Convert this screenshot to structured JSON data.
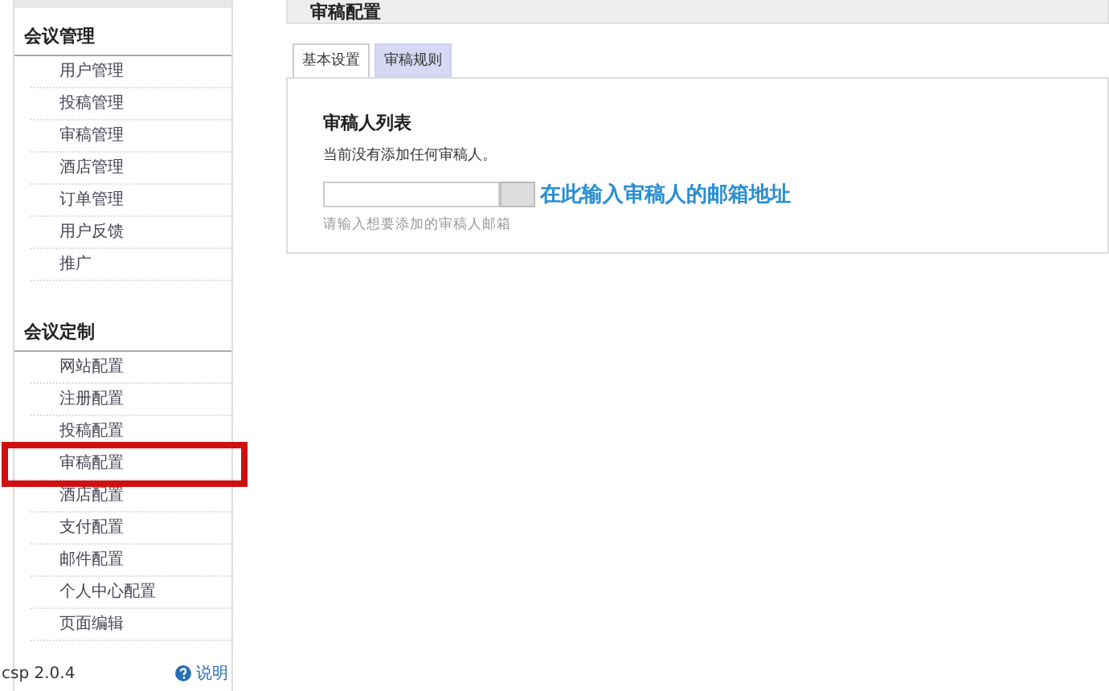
{
  "page_title": "审稿配置",
  "sidebar": {
    "sections": [
      {
        "title": "会议管理",
        "items": [
          {
            "label": "用户管理",
            "highlighted": false
          },
          {
            "label": "投稿管理",
            "highlighted": false
          },
          {
            "label": "审稿管理",
            "highlighted": false
          },
          {
            "label": "酒店管理",
            "highlighted": false
          },
          {
            "label": "订单管理",
            "highlighted": false
          },
          {
            "label": "用户反馈",
            "highlighted": false
          },
          {
            "label": "推广",
            "highlighted": false
          }
        ]
      },
      {
        "title": "会议定制",
        "items": [
          {
            "label": "网站配置",
            "highlighted": false
          },
          {
            "label": "注册配置",
            "highlighted": false
          },
          {
            "label": "投稿配置",
            "highlighted": false
          },
          {
            "label": "审稿配置",
            "highlighted": true
          },
          {
            "label": "酒店配置",
            "highlighted": false
          },
          {
            "label": "支付配置",
            "highlighted": false
          },
          {
            "label": "邮件配置",
            "highlighted": false
          },
          {
            "label": "个人中心配置",
            "highlighted": false
          },
          {
            "label": "页面编辑",
            "highlighted": false
          }
        ]
      }
    ],
    "version": "csp 2.0.4",
    "help": "说明"
  },
  "tabs": [
    {
      "label": "基本设置",
      "selected": true
    },
    {
      "label": "审稿规则",
      "selected": false
    }
  ],
  "panel": {
    "heading": "审稿人列表",
    "empty_text": "当前没有添加任何审稿人。",
    "hint": "请输入想要添加的审稿人邮箱",
    "annotation": "在此输入审稿人的邮箱地址"
  }
}
